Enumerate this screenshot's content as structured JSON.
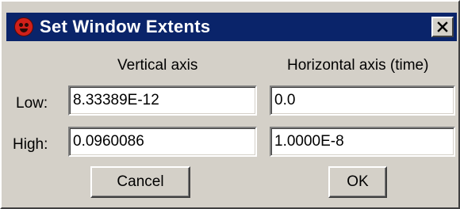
{
  "window": {
    "title": "Set Window Extents",
    "titlebar_color": "#0a246a",
    "background_color": "#d4d0c8",
    "icon": "app-icon",
    "close_icon": "close-icon"
  },
  "columns": {
    "vertical": "Vertical axis",
    "horizontal": "Horizontal axis (time)"
  },
  "rows": {
    "low": {
      "label": "Low:",
      "vertical_value": "8.33389E-12",
      "horizontal_value": "0.0"
    },
    "high": {
      "label": "High:",
      "vertical_value": "0.0960086",
      "horizontal_value": "1.0000E-8"
    }
  },
  "buttons": {
    "cancel": "Cancel",
    "ok": "OK"
  }
}
